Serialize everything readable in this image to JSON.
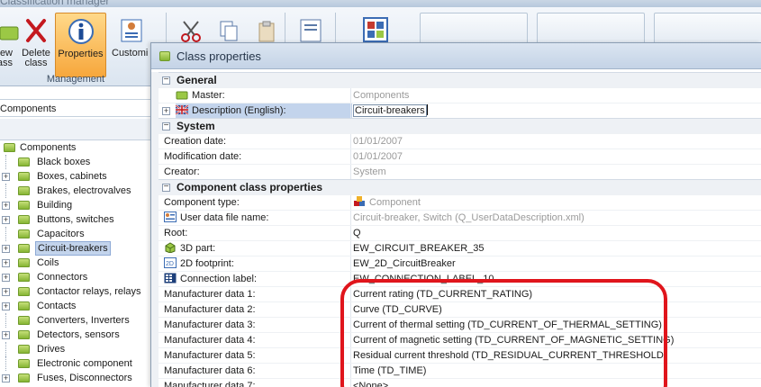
{
  "app": {
    "title": "Classification manager"
  },
  "ribbon": {
    "buttons": [
      {
        "label1": "ew",
        "label2": "ass"
      },
      {
        "label1": "Delete",
        "label2": "class"
      },
      {
        "label1": "Properties",
        "label2": ""
      },
      {
        "label1": "Customi",
        "label2": ""
      }
    ],
    "group_label": "Management"
  },
  "left": {
    "header": "Components",
    "tree": [
      {
        "label": "Components",
        "root": true,
        "expander": false
      },
      {
        "label": "Black boxes",
        "expander": false
      },
      {
        "label": "Boxes, cabinets",
        "expander": true
      },
      {
        "label": "Brakes, electrovalves",
        "expander": false
      },
      {
        "label": "Building",
        "expander": true
      },
      {
        "label": "Buttons, switches",
        "expander": true
      },
      {
        "label": "Capacitors",
        "expander": false
      },
      {
        "label": "Circuit-breakers",
        "expander": true,
        "selected": true
      },
      {
        "label": "Coils",
        "expander": true
      },
      {
        "label": "Connectors",
        "expander": true
      },
      {
        "label": "Contactor relays, relays",
        "expander": true
      },
      {
        "label": "Contacts",
        "expander": true
      },
      {
        "label": "Converters, Inverters",
        "expander": false
      },
      {
        "label": "Detectors, sensors",
        "expander": true
      },
      {
        "label": "Drives",
        "expander": false
      },
      {
        "label": "Electronic component",
        "expander": false
      },
      {
        "label": "Fuses, Disconnectors",
        "expander": true
      }
    ]
  },
  "dialog": {
    "title": "Class properties",
    "categories": {
      "general": "General",
      "system": "System",
      "component": "Component class properties"
    },
    "general": {
      "master_name": "Master:",
      "master_value": "Components",
      "desc_name": "Description (English):",
      "desc_value": "Circuit-breakers"
    },
    "system": {
      "creation_name": "Creation date:",
      "creation_value": "01/01/2007",
      "modification_name": "Modification date:",
      "modification_value": "01/01/2007",
      "creator_name": "Creator:",
      "creator_value": "System"
    },
    "component": {
      "type_name": "Component type:",
      "type_value": "Component",
      "userdata_name": "User data file name:",
      "userdata_value": "Circuit-breaker, Switch (Q_UserDataDescription.xml)",
      "root_name": "Root:",
      "root_value": "Q",
      "part3d_name": "3D part:",
      "part3d_value": "EW_CIRCUIT_BREAKER_35",
      "footprint_name": "2D footprint:",
      "footprint_value": "EW_2D_CircuitBreaker",
      "conn_name": "Connection label:",
      "conn_value": "EW_CONNECTION_LABEL_10"
    },
    "manufacturer": [
      {
        "name": "Manufacturer data 1:",
        "value": "Current rating (TD_CURRENT_RATING)"
      },
      {
        "name": "Manufacturer data 2:",
        "value": "Curve (TD_CURVE)"
      },
      {
        "name": "Manufacturer data 3:",
        "value": "Current of thermal setting (TD_CURRENT_OF_THERMAL_SETTING)"
      },
      {
        "name": "Manufacturer data 4:",
        "value": "Current of magnetic setting (TD_CURRENT_OF_MAGNETIC_SETTING)"
      },
      {
        "name": "Manufacturer data 5:",
        "value": "Residual current threshold (TD_RESIDUAL_CURRENT_THRESHOLD)"
      },
      {
        "name": "Manufacturer data 6:",
        "value": "Time (TD_TIME)"
      },
      {
        "name": "Manufacturer data 7:",
        "value": "<None>"
      }
    ]
  },
  "colors": {
    "highlight": "#e0151c",
    "selection": "#c3d4ec",
    "active_button": "#f7a73c"
  }
}
